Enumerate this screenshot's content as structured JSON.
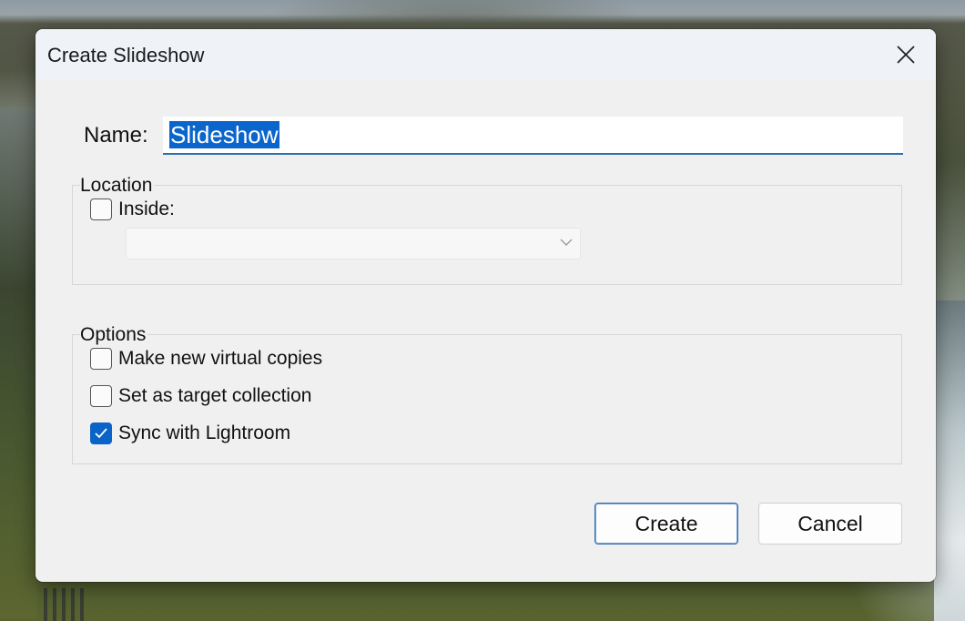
{
  "dialog": {
    "title": "Create Slideshow",
    "close_icon": "close-icon"
  },
  "name_field": {
    "label": "Name:",
    "value": "Slideshow",
    "selected": true
  },
  "location": {
    "legend": "Location",
    "inside": {
      "label": "Inside:",
      "checked": false
    },
    "collection_dropdown": {
      "value": "",
      "enabled": false,
      "icon": "chevron-down-icon"
    }
  },
  "options": {
    "legend": "Options",
    "items": [
      {
        "label": "Make new virtual copies",
        "checked": false
      },
      {
        "label": "Set as target collection",
        "checked": false
      },
      {
        "label": "Sync with Lightroom",
        "checked": true
      }
    ]
  },
  "buttons": {
    "create": "Create",
    "cancel": "Cancel"
  },
  "colors": {
    "accent": "#0a63c6",
    "dialog_bg": "#f0f0f0",
    "titlebar_bg": "#eff3f8"
  }
}
